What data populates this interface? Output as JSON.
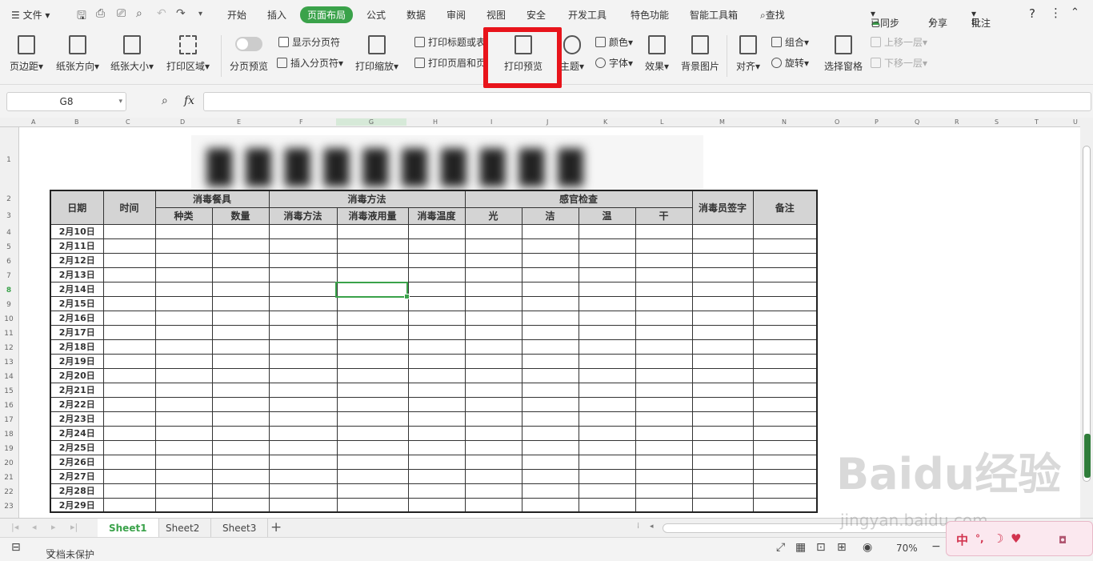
{
  "menu": {
    "file": "文件",
    "tabs": [
      "开始",
      "插入",
      "页面布局",
      "公式",
      "数据",
      "审阅",
      "视图",
      "安全",
      "开发工具",
      "特色功能",
      "智能工具箱"
    ],
    "active_tab": "页面布局",
    "search": "查找",
    "sync": "已同步",
    "share": "分享",
    "comment": "批注"
  },
  "ribbon": {
    "margins": "页边距",
    "orientation": "纸张方向",
    "size": "纸张大小",
    "print_area": "打印区域",
    "page_break_preview": "分页预览",
    "show_page_breaks": "显示分页符",
    "insert_page_break": "插入分页符",
    "print_scale": "打印缩放",
    "print_titles": "打印标题或表",
    "print_header_footer": "打印页眉和页",
    "print_preview": "打印预览",
    "theme": "主题",
    "colors": "颜色",
    "fonts": "字体",
    "effects": "效果",
    "background": "背景图片",
    "align": "对齐",
    "group": "组合",
    "rotate": "旋转",
    "selection_pane": "选择窗格",
    "bring_forward": "上移一层",
    "send_backward": "下移一层"
  },
  "formula_bar": {
    "name_box": "G8",
    "fx": "fx",
    "value": ""
  },
  "columns": [
    "A",
    "B",
    "C",
    "D",
    "E",
    "F",
    "G",
    "H",
    "I",
    "J",
    "K",
    "L",
    "M",
    "N",
    "O",
    "P",
    "Q",
    "R",
    "S",
    "T",
    "U"
  ],
  "rows": [
    "1",
    "2",
    "3",
    "4",
    "5",
    "6",
    "7",
    "8",
    "9",
    "10",
    "11",
    "12",
    "13",
    "14",
    "15",
    "16",
    "17",
    "18",
    "19",
    "20",
    "21",
    "22",
    "23"
  ],
  "table": {
    "header1": {
      "date": "日期",
      "time": "时间",
      "tableware": "消毒餐具",
      "method": "消毒方法",
      "sensory": "感官检查",
      "signer": "消毒员签字",
      "remark": "备注"
    },
    "header2": [
      "种类",
      "数量",
      "消毒方法",
      "消毒液用量",
      "消毒温度",
      "光",
      "洁",
      "温",
      "干"
    ],
    "dates": [
      "2月10日",
      "2月11日",
      "2月12日",
      "2月13日",
      "2月14日",
      "2月15日",
      "2月16日",
      "2月17日",
      "2月18日",
      "2月19日",
      "2月20日",
      "2月21日",
      "2月22日",
      "2月23日",
      "2月24日",
      "2月25日",
      "2月26日",
      "2月27日",
      "2月28日",
      "2月29日"
    ]
  },
  "sheets": [
    "Sheet1",
    "Sheet2",
    "Sheet3"
  ],
  "active_sheet": "Sheet1",
  "status": {
    "protect": "文档未保护",
    "zoom": "70%"
  },
  "watermark": {
    "brand": "Baidu经验",
    "url": "jingyan.baidu.com"
  },
  "ime": {
    "mode": "中"
  },
  "colors": {
    "accent": "#3aa24a",
    "highlight": "#e8141b"
  }
}
